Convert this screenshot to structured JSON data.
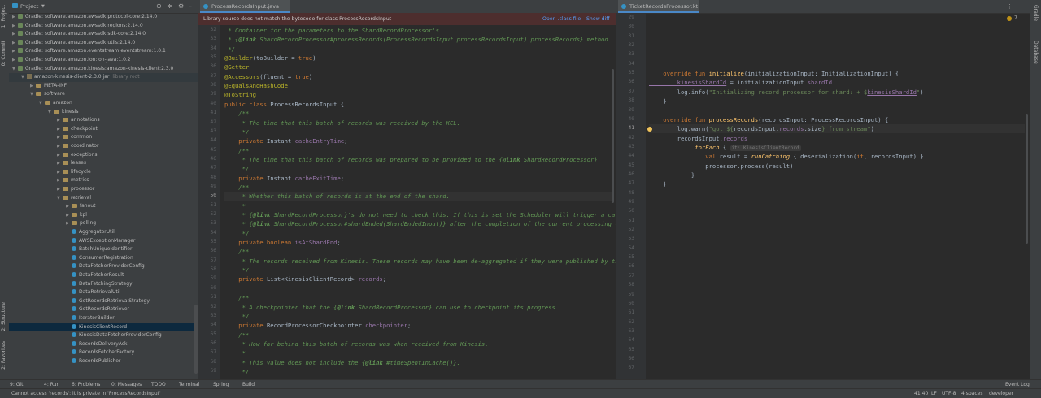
{
  "left_strip": {
    "project_label": "1: Project",
    "commit_label": "0: Commit",
    "structure_label": "2: Structure",
    "favorites_label": "2: Favorites"
  },
  "right_strip": {
    "gradle_label": "Gradle",
    "database_label": "Database"
  },
  "project": {
    "title": "Project",
    "tree": [
      {
        "label": "Gradle: software.amazon.awssdk:protocol-core:2.14.0",
        "kind": "gradle",
        "indent": 0
      },
      {
        "label": "Gradle: software.amazon.awssdk:regions:2.14.0",
        "kind": "gradle",
        "indent": 0
      },
      {
        "label": "Gradle: software.amazon.awssdk:sdk-core:2.14.0",
        "kind": "gradle",
        "indent": 0
      },
      {
        "label": "Gradle: software.amazon.awssdk:utils:2.14.0",
        "kind": "gradle",
        "indent": 0
      },
      {
        "label": "Gradle: software.amazon.eventstream:eventstream:1.0.1",
        "kind": "gradle",
        "indent": 0
      },
      {
        "label": "Gradle: software.amazon.ion:ion-java:1.0.2",
        "kind": "gradle",
        "indent": 0
      },
      {
        "label": "Gradle: software.amazon.kinesis:amazon-kinesis-client:2.3.0",
        "kind": "gradle",
        "indent": 0,
        "open": true
      },
      {
        "label": "amazon-kinesis-client-2.3.0.jar",
        "suffix": "library root",
        "kind": "jar",
        "indent": 1,
        "open": true,
        "lib": true
      },
      {
        "label": "META-INF",
        "kind": "folder",
        "indent": 2
      },
      {
        "label": "software",
        "kind": "folder",
        "indent": 2,
        "open": true
      },
      {
        "label": "amazon",
        "kind": "folder",
        "indent": 3,
        "open": true
      },
      {
        "label": "kinesis",
        "kind": "folder",
        "indent": 4,
        "open": true
      },
      {
        "label": "annotations",
        "kind": "folder",
        "indent": 5
      },
      {
        "label": "checkpoint",
        "kind": "folder",
        "indent": 5
      },
      {
        "label": "common",
        "kind": "folder",
        "indent": 5
      },
      {
        "label": "coordinator",
        "kind": "folder",
        "indent": 5
      },
      {
        "label": "exceptions",
        "kind": "folder",
        "indent": 5
      },
      {
        "label": "leases",
        "kind": "folder",
        "indent": 5
      },
      {
        "label": "lifecycle",
        "kind": "folder",
        "indent": 5
      },
      {
        "label": "metrics",
        "kind": "folder",
        "indent": 5
      },
      {
        "label": "processor",
        "kind": "folder",
        "indent": 5
      },
      {
        "label": "retrieval",
        "kind": "folder",
        "indent": 5,
        "open": true
      },
      {
        "label": "fanout",
        "kind": "folder",
        "indent": 6
      },
      {
        "label": "kpl",
        "kind": "folder",
        "indent": 6
      },
      {
        "label": "polling",
        "kind": "folder",
        "indent": 6
      },
      {
        "label": "AggregatorUtil",
        "kind": "class",
        "indent": 6
      },
      {
        "label": "AWSExceptionManager",
        "kind": "class",
        "indent": 6
      },
      {
        "label": "BatchUniqueIdentifier",
        "kind": "class",
        "indent": 6
      },
      {
        "label": "ConsumerRegistration",
        "kind": "class",
        "indent": 6
      },
      {
        "label": "DataFetcherProviderConfig",
        "kind": "class",
        "indent": 6
      },
      {
        "label": "DataFetcherResult",
        "kind": "class",
        "indent": 6
      },
      {
        "label": "DataFetchingStrategy",
        "kind": "class",
        "indent": 6
      },
      {
        "label": "DataRetrievalUtil",
        "kind": "class",
        "indent": 6
      },
      {
        "label": "GetRecordsRetrievalStrategy",
        "kind": "class",
        "indent": 6
      },
      {
        "label": "GetRecordsRetriever",
        "kind": "class",
        "indent": 6
      },
      {
        "label": "IteratorBuilder",
        "kind": "class",
        "indent": 6
      },
      {
        "label": "KinesisClientRecord",
        "kind": "class",
        "indent": 6,
        "selected": true
      },
      {
        "label": "KinesisDataFetcherProviderConfig",
        "kind": "class",
        "indent": 6
      },
      {
        "label": "RecordsDeliveryAck",
        "kind": "class",
        "indent": 6
      },
      {
        "label": "RecordsFetcherFactory",
        "kind": "class",
        "indent": 6
      },
      {
        "label": "RecordsPublisher",
        "kind": "class",
        "indent": 6
      }
    ]
  },
  "editor1": {
    "tab": "ProcessRecordsInput.java",
    "banner": {
      "message": "Library source does not match the bytecode for class ProcessRecordsInput",
      "open_class_file": "Open .class file",
      "show_diff": "Show diff"
    },
    "first_line": 32,
    "current_line": 50,
    "lines": [
      [
        [
          "c",
          " * Container for the parameters to the ShardRecordProcessor's"
        ]
      ],
      [
        [
          "c",
          " * {"
        ],
        [
          "c b",
          "@link"
        ],
        [
          "c",
          " ShardRecordProcessor#processRecords(ProcessRecordsInput processRecordsInput) processRecords} method."
        ]
      ],
      [
        [
          "c",
          " */"
        ]
      ],
      [
        [
          "a",
          "@Builder"
        ],
        [
          "",
          "(toBuilder = "
        ],
        [
          "k",
          "true"
        ],
        [
          "",
          ")"
        ]
      ],
      [
        [
          "a",
          "@Getter"
        ]
      ],
      [
        [
          "a",
          "@Accessors"
        ],
        [
          "",
          "(fluent = "
        ],
        [
          "k",
          "true"
        ],
        [
          "",
          ")"
        ]
      ],
      [
        [
          "a",
          "@EqualsAndHashCode"
        ]
      ],
      [
        [
          "a",
          "@ToString"
        ]
      ],
      [
        [
          "k",
          "public class "
        ],
        [
          "",
          "ProcessRecordsInput {"
        ]
      ],
      [
        [
          "c",
          "    /**"
        ]
      ],
      [
        [
          "c",
          "     * The time that this batch of records was received by the KCL."
        ]
      ],
      [
        [
          "c",
          "     */"
        ]
      ],
      [
        [
          "k",
          "    private "
        ],
        [
          "",
          "Instant "
        ],
        [
          "f",
          "cacheEntryTime"
        ],
        [
          "",
          ";"
        ]
      ],
      [
        [
          "c",
          "    /**"
        ]
      ],
      [
        [
          "c",
          "     * The time that this batch of records was prepared to be provided to the {"
        ],
        [
          "c b",
          "@link"
        ],
        [
          "c",
          " ShardRecordProcessor}"
        ]
      ],
      [
        [
          "c",
          "     */"
        ]
      ],
      [
        [
          "k",
          "    private "
        ],
        [
          "",
          "Instant "
        ],
        [
          "f",
          "cacheExitTime"
        ],
        [
          "",
          ";"
        ]
      ],
      [
        [
          "c",
          "    /**"
        ]
      ],
      [
        [
          "c",
          "     * Whether this batch of records is at the end of the shard."
        ]
      ],
      [
        [
          "c",
          "     *"
        ]
      ],
      [
        [
          "c",
          "     * {"
        ],
        [
          "c b",
          "@link"
        ],
        [
          "c",
          " ShardRecordProcessor}'s do not need to check this. If this is set the Scheduler will trigger a call to"
        ]
      ],
      [
        [
          "c",
          "     * {"
        ],
        [
          "c b",
          "@link"
        ],
        [
          "c",
          " ShardRecordProcessor#shardEnded(ShardEndedInput)} after the completion of the current processing call."
        ]
      ],
      [
        [
          "c",
          "     */"
        ]
      ],
      [
        [
          "k",
          "    private boolean "
        ],
        [
          "f",
          "isAtShardEnd"
        ],
        [
          "",
          ";"
        ]
      ],
      [
        [
          "c",
          "    /**"
        ]
      ],
      [
        [
          "c",
          "     * The records received from Kinesis. These records may have been de-aggregated if they were published by the KPL."
        ]
      ],
      [
        [
          "c",
          "     */"
        ]
      ],
      [
        [
          "k",
          "    private "
        ],
        [
          "",
          "List<KinesisClientRecord> "
        ],
        [
          "f",
          "records"
        ],
        [
          "",
          ";"
        ]
      ],
      [
        [
          "",
          ""
        ]
      ],
      [
        [
          "c",
          "    /**"
        ]
      ],
      [
        [
          "c",
          "     * A checkpointer that the {"
        ],
        [
          "c b",
          "@link"
        ],
        [
          "c",
          " ShardRecordProcessor} can use to checkpoint its progress."
        ]
      ],
      [
        [
          "c",
          "     */"
        ]
      ],
      [
        [
          "k",
          "    private "
        ],
        [
          "",
          "RecordProcessorCheckpointer "
        ],
        [
          "f",
          "checkpointer"
        ],
        [
          "",
          ";"
        ]
      ],
      [
        [
          "c",
          "    /**"
        ]
      ],
      [
        [
          "c",
          "     * How far behind this batch of records was when received from Kinesis."
        ]
      ],
      [
        [
          "c",
          "     *"
        ]
      ],
      [
        [
          "c",
          "     * This value does not include the {"
        ],
        [
          "c b",
          "@link"
        ],
        [
          "c",
          " #timeSpentInCache()}."
        ]
      ],
      [
        [
          "c",
          "     */"
        ]
      ]
    ]
  },
  "editor2": {
    "tab": "TicketRecordsProcessor.kt",
    "first_line": 29,
    "current_line": 41,
    "warnings": "7",
    "lines": [
      [
        [
          "",
          ""
        ]
      ],
      [
        [
          "",
          ""
        ]
      ],
      [
        [
          "",
          ""
        ]
      ],
      [
        [
          "",
          ""
        ]
      ],
      [
        [
          "",
          ""
        ]
      ],
      [
        [
          "",
          ""
        ]
      ],
      [
        [
          "k",
          "    override fun "
        ],
        [
          "fn",
          "initialize"
        ],
        [
          "",
          "(initializationInput: InitializationInput) {"
        ]
      ],
      [
        [
          "f u",
          "        kinesisShardId"
        ],
        [
          "",
          " = initializationInput."
        ],
        [
          "f",
          "shardId"
        ]
      ],
      [
        [
          "",
          "        log.info("
        ],
        [
          "s",
          "\"Initializing record processor for shard: + $"
        ],
        [
          "f u",
          "kinesisShardId"
        ],
        [
          "s",
          "\""
        ],
        [
          "",
          ")"
        ]
      ],
      [
        [
          "",
          "    }"
        ]
      ],
      [
        [
          "",
          ""
        ]
      ],
      [
        [
          "k",
          "    override fun "
        ],
        [
          "fn",
          "processRecords"
        ],
        [
          "",
          "(recordsInput: ProcessRecordsInput) {"
        ]
      ],
      [
        [
          "",
          "        log.warn("
        ],
        [
          "s",
          "\"got ${"
        ],
        [
          "",
          "recordsInput."
        ],
        [
          "f",
          "records"
        ],
        [
          "",
          ".size"
        ],
        [
          "s",
          "} from stream\""
        ],
        [
          "",
          ")"
        ]
      ],
      [
        [
          "",
          "        recordsInput."
        ],
        [
          "f",
          "records"
        ]
      ],
      [
        [
          "",
          "            ."
        ],
        [
          "fn it",
          "forEach"
        ],
        [
          "",
          " { "
        ],
        [
          "hint",
          "it: KinesisClientRecord"
        ]
      ],
      [
        [
          "k",
          "                val "
        ],
        [
          "",
          "result = "
        ],
        [
          "fn it",
          "runCatching"
        ],
        [
          "",
          " { deserialization("
        ],
        [
          "k",
          "it"
        ],
        [
          "",
          ", recordsInput) }"
        ]
      ],
      [
        [
          "",
          "                processor.process(result)"
        ]
      ],
      [
        [
          "",
          "            }"
        ]
      ],
      [
        [
          "",
          "    }"
        ]
      ],
      [
        [
          "",
          ""
        ]
      ],
      [
        [
          "",
          ""
        ]
      ],
      [
        [
          "",
          ""
        ]
      ],
      [
        [
          "",
          ""
        ]
      ],
      [
        [
          "",
          ""
        ]
      ],
      [
        [
          "",
          ""
        ]
      ],
      [
        [
          "",
          ""
        ]
      ],
      [
        [
          "",
          ""
        ]
      ],
      [
        [
          "",
          ""
        ]
      ],
      [
        [
          "",
          ""
        ]
      ],
      [
        [
          "",
          ""
        ]
      ],
      [
        [
          "",
          ""
        ]
      ],
      [
        [
          "",
          ""
        ]
      ],
      [
        [
          "",
          ""
        ]
      ],
      [
        [
          "",
          ""
        ]
      ],
      [
        [
          "",
          ""
        ]
      ],
      [
        [
          "",
          ""
        ]
      ],
      [
        [
          "",
          ""
        ]
      ],
      [
        [
          "",
          ""
        ]
      ],
      [
        [
          "",
          ""
        ]
      ]
    ]
  },
  "tool_tabs": {
    "git": "9: Git",
    "run": "4: Run",
    "problems": "6: Problems",
    "messages": "0: Messages",
    "todo": "TODO",
    "terminal": "Terminal",
    "spring": "Spring",
    "build": "Build",
    "event_log": "Event Log"
  },
  "status": {
    "message": "Cannot access 'records': it is private in 'ProcessRecordsInput'",
    "position": "41:40",
    "line_sep": "LF",
    "encoding": "UTF-8",
    "indent": "4 spaces",
    "branch": "developer"
  }
}
